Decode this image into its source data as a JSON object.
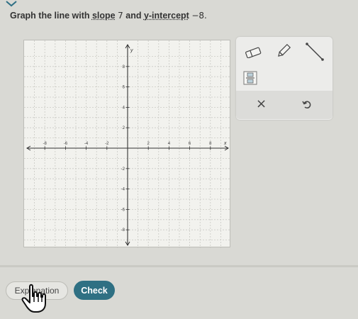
{
  "question": {
    "prefix": "Graph the line with ",
    "slope_link": "slope",
    "slope_value": "7",
    "middle": " and ",
    "intercept_link": "y-intercept",
    "intercept_value": "−8."
  },
  "graph": {
    "x_label": "x",
    "y_label": "y",
    "x_ticks": [
      {
        "value": -8,
        "label": "-8"
      },
      {
        "value": -6,
        "label": "-6"
      },
      {
        "value": -4,
        "label": "-4"
      },
      {
        "value": -2,
        "label": "-2"
      },
      {
        "value": 2,
        "label": "2"
      },
      {
        "value": 4,
        "label": "4"
      },
      {
        "value": 6,
        "label": "6"
      },
      {
        "value": 8,
        "label": "8"
      }
    ],
    "y_ticks": [
      {
        "value": 8,
        "label": "8"
      },
      {
        "value": 6,
        "label": "6"
      },
      {
        "value": 4,
        "label": "4"
      },
      {
        "value": 2,
        "label": "2"
      },
      {
        "value": -2,
        "label": "-2"
      },
      {
        "value": -4,
        "label": "-4"
      },
      {
        "value": -6,
        "label": "-6"
      },
      {
        "value": -8,
        "label": "-8"
      }
    ],
    "range": [
      -9,
      9
    ]
  },
  "tools": {
    "eraser": "eraser-icon",
    "pencil": "pencil-icon",
    "line": "line-segment-icon",
    "fraction": "fraction-icon",
    "clear_symbol": "×",
    "undo": "undo-icon"
  },
  "buttons": {
    "explanation": "Explanation",
    "check": "Check"
  },
  "colors": {
    "check_button": "#2f7083",
    "background": "#d9d9d4"
  }
}
